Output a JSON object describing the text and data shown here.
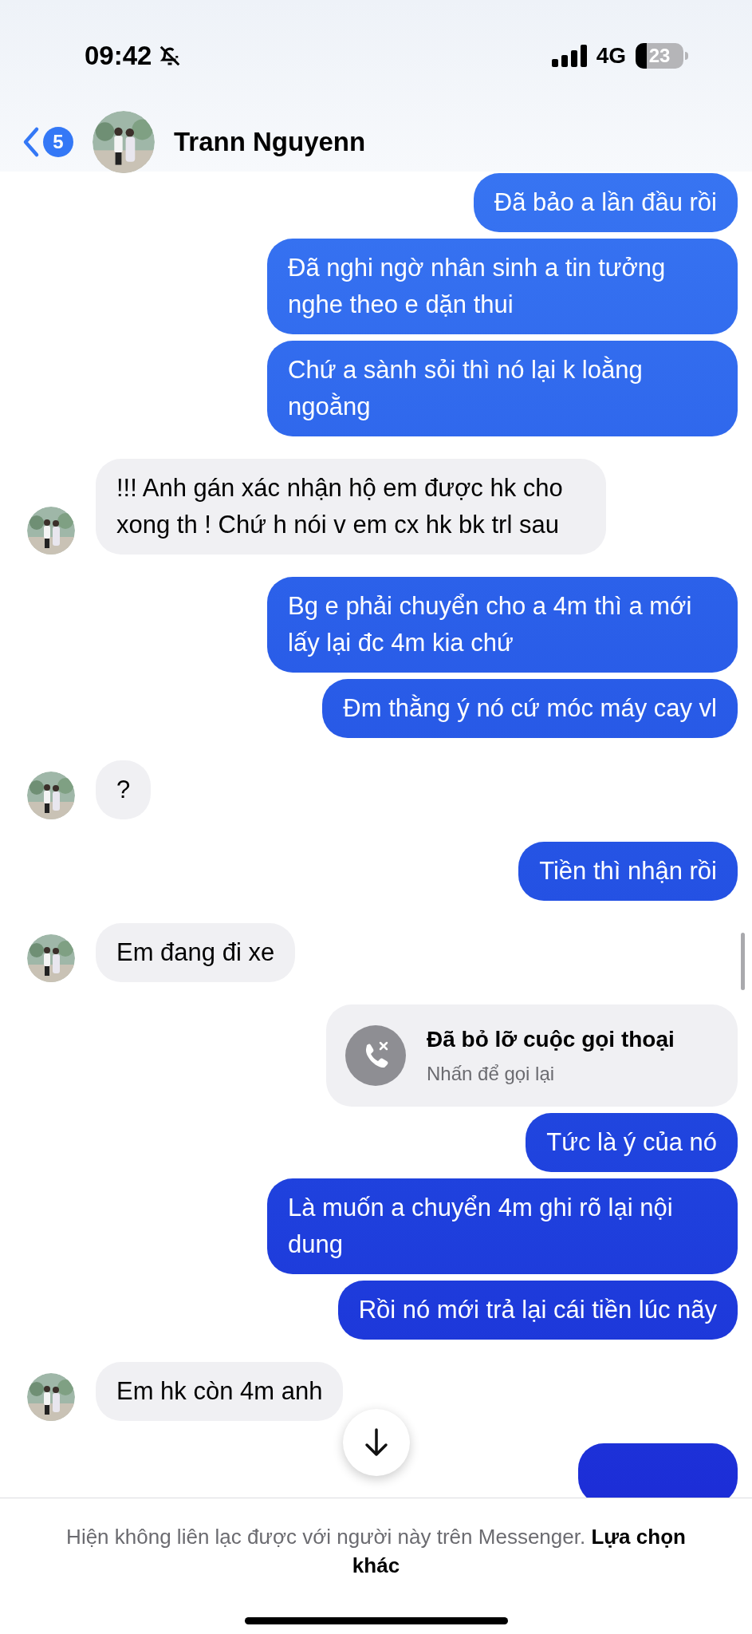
{
  "status_bar": {
    "time": "09:42",
    "network": "4G",
    "battery": "23"
  },
  "header": {
    "unread_count": "5",
    "contact_name": "Trann Nguyenn"
  },
  "messages": [
    {
      "kind": "outgoing",
      "text": "Đã bảo a lần đầu rồi"
    },
    {
      "kind": "outgoing",
      "text": "Đã nghi ngờ nhân sinh a tin tưởng nghe theo e dặn thui"
    },
    {
      "kind": "outgoing",
      "text": "Chứ a sành sỏi thì nó lại k loằng ngoằng"
    },
    {
      "kind": "incoming",
      "text": "!!! Anh gán xác nhận hộ em được hk cho xong th ! Chứ h nói v em cx hk bk trl sau"
    },
    {
      "kind": "outgoing",
      "text": "Bg e phải chuyển cho a 4m thì a mới lấy lại đc 4m kia chứ"
    },
    {
      "kind": "outgoing",
      "text": "Đm thằng ý nó cứ móc máy cay vl"
    },
    {
      "kind": "incoming",
      "text": "?"
    },
    {
      "kind": "outgoing",
      "text": "Tiền thì nhận rồi"
    },
    {
      "kind": "incoming",
      "text": "Em đang đi xe"
    },
    {
      "kind": "missed_call",
      "title": "Đã bỏ lỡ cuộc gọi thoại",
      "subtitle": "Nhấn để gọi lại"
    },
    {
      "kind": "outgoing",
      "text": "Tức là ý của nó"
    },
    {
      "kind": "outgoing",
      "text": "Là muốn a chuyển 4m ghi rõ lại nội dung"
    },
    {
      "kind": "outgoing",
      "text": "Rồi nó mới trả lại cái tiền lúc nãy"
    },
    {
      "kind": "incoming",
      "text": "Em hk còn 4m anh"
    },
    {
      "kind": "outgoing_cut"
    }
  ],
  "footer": {
    "notice": "Hiện không liên lạc được với người này trên Messenger. **Lựa chọn khác**"
  }
}
